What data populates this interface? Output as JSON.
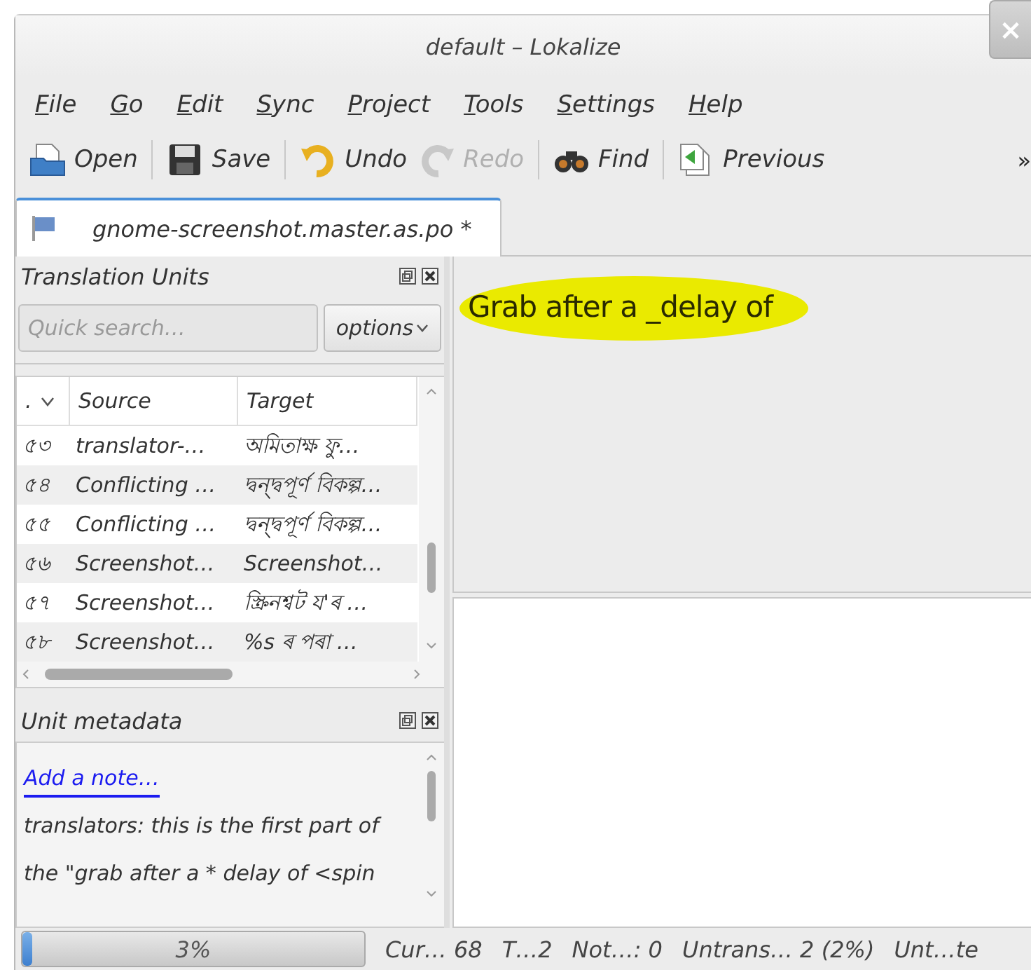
{
  "window": {
    "title": "default – Lokalize",
    "close": "×"
  },
  "menu": [
    {
      "label": "File"
    },
    {
      "label": "Go"
    },
    {
      "label": "Edit"
    },
    {
      "label": "Sync"
    },
    {
      "label": "Project"
    },
    {
      "label": "Tools"
    },
    {
      "label": "Settings"
    },
    {
      "label": "Help"
    }
  ],
  "toolbar": [
    {
      "kind": "open",
      "label": "Open",
      "disabled": false
    },
    {
      "kind": "save",
      "label": "Save",
      "disabled": false
    },
    {
      "kind": "undo",
      "label": "Undo",
      "disabled": false
    },
    {
      "kind": "redo",
      "label": "Redo",
      "disabled": true
    },
    {
      "kind": "find",
      "label": "Find",
      "disabled": false
    },
    {
      "kind": "previous",
      "label": "Previous",
      "disabled": false
    }
  ],
  "toolbar_overflow": "»",
  "tabs": [
    {
      "label": "gnome-screenshot.master.as.po *",
      "selected": true
    }
  ],
  "units_panel": {
    "title": "Translation Units",
    "search": {
      "placeholder": "Quick search…"
    },
    "options_button": "options",
    "columns": [
      ".",
      "Source",
      "Target"
    ],
    "rows": [
      {
        "number": "৫৩",
        "source": "translator-…",
        "target": "অমিতাক্ষ ফু…"
      },
      {
        "number": "৫৪",
        "source": "Conflicting …",
        "target": "দ্বন্দ্বপূৰ্ণ বিকল্প…"
      },
      {
        "number": "৫৫",
        "source": "Conflicting …",
        "target": "দ্বন্দ্বপূৰ্ণ বিকল্প…"
      },
      {
        "number": "৫৬",
        "source": "Screenshot…",
        "target": "Screenshot…"
      },
      {
        "number": "৫৭",
        "source": "Screenshot…",
        "target": "স্ক্ৰিনশ্বট য'ৰ …"
      },
      {
        "number": "৫৮",
        "source": "Screenshot…",
        "target": "%s ৰ পৰা …"
      }
    ]
  },
  "metadata_panel": {
    "title": "Unit metadata",
    "link": "Add a note…",
    "note": "translators: this is the first part of the \"grab after a * delay of <spin"
  },
  "editor": {
    "source_text": "Grab after a _delay of"
  },
  "status_bar": {
    "progress": {
      "level": 0.03,
      "label": "3%"
    },
    "fields": [
      "Cur… 68",
      "T…2",
      "Not…: 0",
      "Untrans… 2 (2%)",
      "Unt…te"
    ]
  }
}
